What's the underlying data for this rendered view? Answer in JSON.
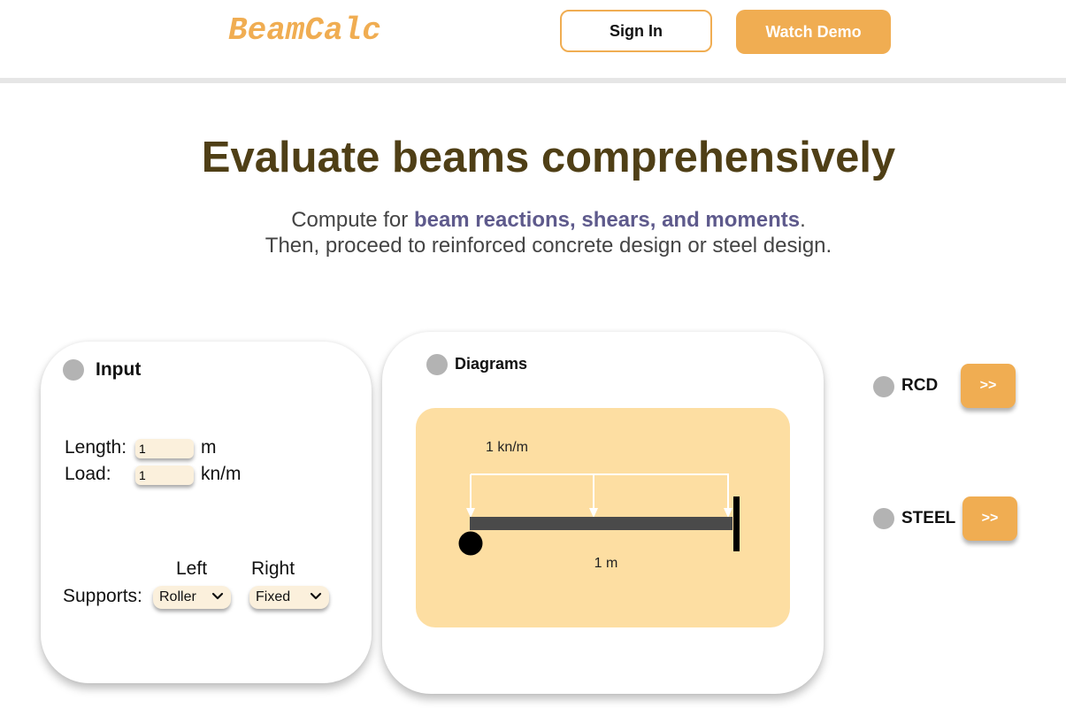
{
  "header": {
    "logo": "BeamCalc",
    "sign_in": "Sign In",
    "watch_demo": "Watch Demo"
  },
  "hero": {
    "title": "Evaluate beams comprehensively",
    "line1_prefix": "Compute for ",
    "line1_highlight": "beam reactions, shears, and moments",
    "line1_suffix": ".",
    "line2": "Then, proceed to reinforced concrete design or steel design."
  },
  "input_card": {
    "title": "Input",
    "length_label": "Length:",
    "length_value": "1",
    "length_unit": "m",
    "load_label": "Load:",
    "load_value": "1",
    "load_unit": "kn/m",
    "left_label": "Left",
    "right_label": "Right",
    "supports_label": "Supports:",
    "left_support": "Roller",
    "right_support": "Fixed"
  },
  "diagrams_card": {
    "title": "Diagrams",
    "load_text": "1 kn/m",
    "length_text": "1 m"
  },
  "side": {
    "rcd_label": "RCD",
    "rcd_button": ">>",
    "steel_label": "STEEL",
    "steel_button": ">>"
  },
  "colors": {
    "accent": "#f0ad52",
    "title": "#4f3f16",
    "highlight": "#5e5a8c",
    "diagram_bg": "#fddea2",
    "input_bg": "#fbf0dc"
  }
}
